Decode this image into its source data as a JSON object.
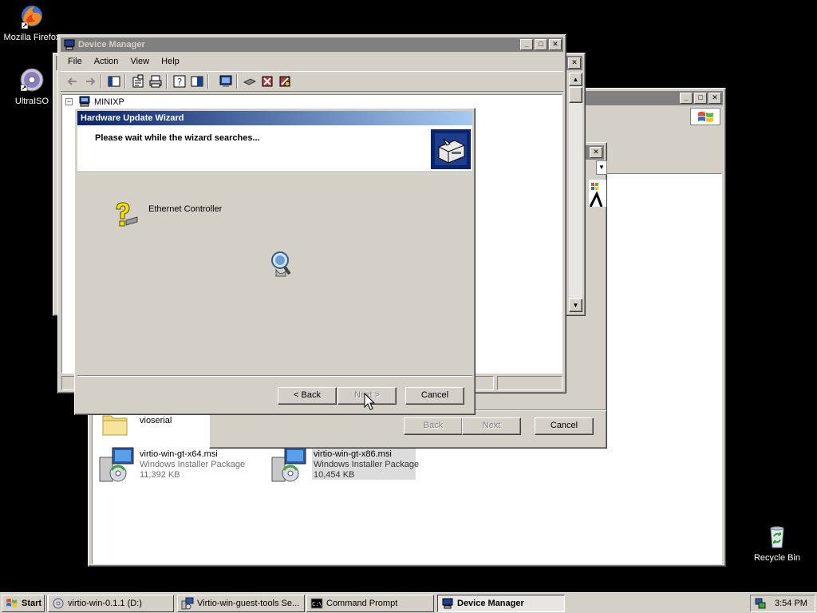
{
  "desktop": {
    "icons": [
      {
        "label": "Mozilla Firefox"
      },
      {
        "label": "UltraISO"
      },
      {
        "label": "Recycle Bin"
      }
    ]
  },
  "back_window": {
    "files": [
      {
        "name": "vioserial"
      },
      {
        "name": "virtio-win-gt-x64.msi",
        "type": "Windows Installer Package",
        "size": "11,392 KB"
      },
      {
        "name": "virtio-win-gt-x86.msi",
        "type": "Windows Installer Package",
        "size": "10,454 KB"
      }
    ]
  },
  "mid_window": {
    "back_label": "Back",
    "next_label": "Next",
    "cancel_label": "Cancel"
  },
  "device_manager": {
    "title": "Device Manager",
    "menu": [
      "File",
      "Action",
      "View",
      "Help"
    ],
    "tree_root": "MINIXP"
  },
  "wizard": {
    "title": "Hardware Update Wizard",
    "header": "Please wait while the wizard searches...",
    "device": "Ethernet Controller",
    "back_label": "< Back",
    "next_label": "Next >",
    "cancel_label": "Cancel"
  },
  "taskbar": {
    "start_label": "Start",
    "tasks": [
      {
        "label": "virtio-win-0.1.1 (D:)"
      },
      {
        "label": "Virtio-win-guest-tools Se..."
      },
      {
        "label": "Command Prompt"
      },
      {
        "label": "Device Manager"
      }
    ],
    "clock": "3:54 PM"
  },
  "colors": {
    "desktop": "#000000",
    "face": "#d4d0c8",
    "active_title_start": "#0a246a",
    "active_title_end": "#a6caf0",
    "inactive_title": "#808080"
  }
}
